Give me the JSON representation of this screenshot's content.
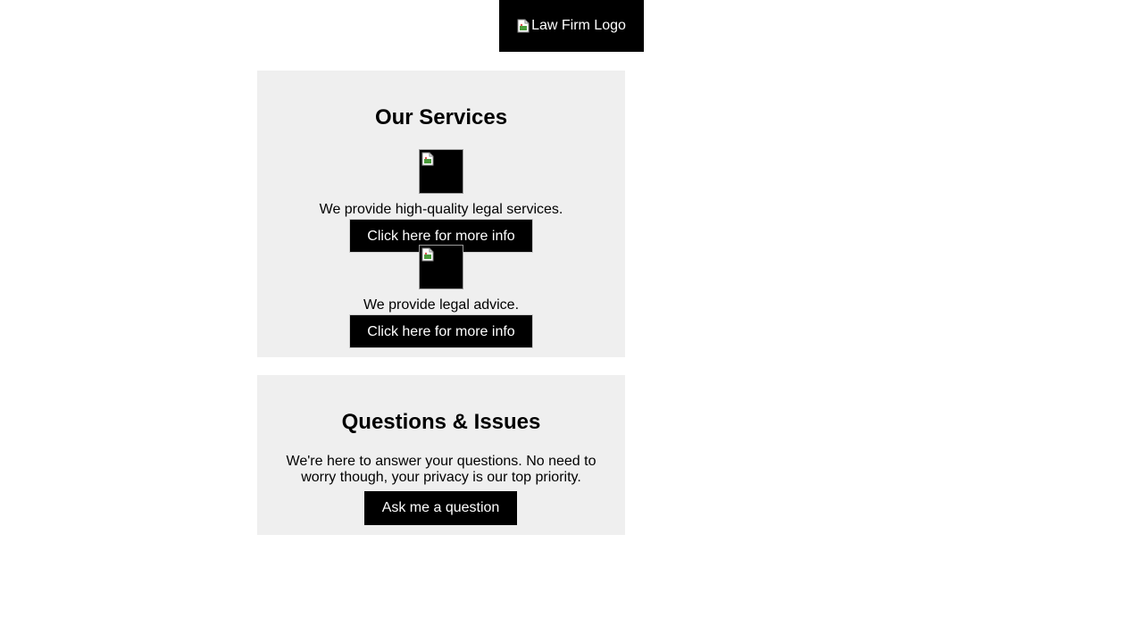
{
  "header": {
    "logo_alt": "Law Firm Logo"
  },
  "services": {
    "title": "Our Services",
    "items": [
      {
        "image_icon": "broken-image-icon",
        "description": "We provide high-quality legal services.",
        "button_label": "Click here for more info"
      },
      {
        "image_icon": "broken-image-icon",
        "description": "We provide legal advice.",
        "button_label": "Click here for more info"
      }
    ]
  },
  "questions": {
    "title": "Questions & Issues",
    "description": "We're here to answer your questions. No need to worry though, your privacy is our top priority.",
    "button_label": "Ask me a question"
  },
  "colors": {
    "primary": "#000000",
    "section_bg": "#efefef",
    "text_on_primary": "#ffffff"
  }
}
